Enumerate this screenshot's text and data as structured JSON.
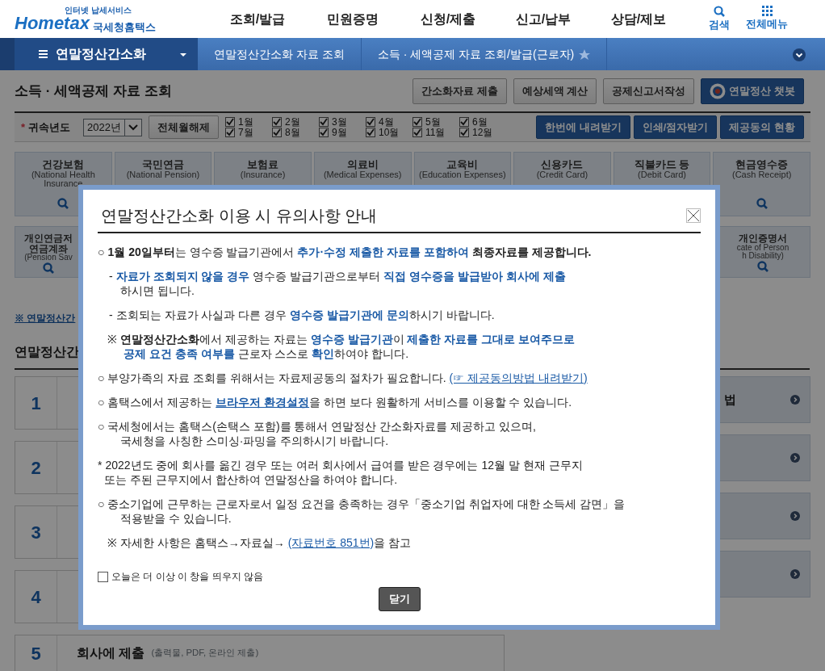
{
  "header": {
    "logo": {
      "tagline": "인터넷 납세서비스",
      "brand": "Hometax",
      "name": "국세청홈택스"
    },
    "menu": [
      "조회/발급",
      "민원증명",
      "신청/제출",
      "신고/납부",
      "상담/제보"
    ],
    "tools": [
      {
        "label": "검색",
        "kind": "search"
      },
      {
        "label": "전체메뉴",
        "kind": "grid"
      }
    ]
  },
  "breadcrumb": {
    "menu_title": "연말정산간소화",
    "items": [
      "연말정산간소화 자료 조회",
      "소득 · 세액공제 자료 조회/발급(근로자)"
    ],
    "favorite": false
  },
  "page": {
    "title": "소득 · 세액공제 자료 조회",
    "actions": [
      {
        "label": "간소화자료 제출",
        "kind": "default"
      },
      {
        "label": "예상세액 계산",
        "kind": "default"
      },
      {
        "label": "공제신고서작성",
        "kind": "default"
      },
      {
        "label": "연말정산 챗봇",
        "kind": "chatbot"
      }
    ]
  },
  "filter": {
    "required_mark": "*",
    "label": "귀속년도",
    "year": "2022년",
    "clear_button": "전체월해제",
    "months": [
      {
        "label": "1월",
        "checked": true
      },
      {
        "label": "7월",
        "checked": true
      },
      {
        "label": "2월",
        "checked": true
      },
      {
        "label": "8월",
        "checked": true
      },
      {
        "label": "3월",
        "checked": true
      },
      {
        "label": "9월",
        "checked": true
      },
      {
        "label": "4월",
        "checked": true
      },
      {
        "label": "10월",
        "checked": true
      },
      {
        "label": "5월",
        "checked": true
      },
      {
        "label": "11월",
        "checked": true
      },
      {
        "label": "6월",
        "checked": true
      },
      {
        "label": "12월",
        "checked": true
      }
    ],
    "actions": [
      "한번에 내려받기",
      "인쇄/점자받기",
      "제공동의 현황"
    ]
  },
  "categories": [
    {
      "title": "건강보험",
      "subtitle": [
        "(National Health",
        "Insurance"
      ],
      "search_icon": true
    },
    {
      "title": "국민연금",
      "subtitle": [
        "(National Pension)"
      ],
      "search_icon": false
    },
    {
      "title": "보험료",
      "subtitle": [
        "(Insurance)"
      ],
      "search_icon": false
    },
    {
      "title": "의료비",
      "subtitle": [
        "(Medical Expenses)"
      ],
      "search_icon": false
    },
    {
      "title": "교육비",
      "subtitle": [
        "(Education Expenses)"
      ],
      "search_icon": false
    },
    {
      "title": "신용카드",
      "subtitle": [
        "(Credit Card)"
      ],
      "search_icon": false
    },
    {
      "title": "직불카드 등",
      "subtitle": [
        "(Debit Card)"
      ],
      "search_icon": false
    },
    {
      "title": "현금영수증",
      "subtitle": [
        "(Cash Receipt)"
      ],
      "search_icon": true
    }
  ],
  "categories_row_2": [
    {
      "title": [
        "개인연금저",
        "연금계좌"
      ],
      "subtitle": [
        "(Pension Sav"
      ]
    },
    {
      "title": [
        "개인증명서"
      ],
      "subtitle": [
        "cate of Person",
        "h Disability)"
      ]
    }
  ],
  "notice_link": "※ 연말정산간",
  "section_title": "연말정산간",
  "steps": [
    {
      "number": "1"
    },
    {
      "number": "2"
    },
    {
      "number": "3"
    },
    {
      "number": "4"
    },
    {
      "number": "5",
      "title": "회사에 제출",
      "note": "(출력물, PDF, 온라인 제출)"
    }
  ],
  "side_links": [
    {
      "kind": "arrow",
      "label": "법"
    },
    {
      "kind": "arrow"
    },
    {
      "kind": "arrow"
    },
    {
      "kind": "arrow"
    }
  ],
  "modal": {
    "title": "연말정산간소화 이용 시 유의사항 안내",
    "blocks": [
      {
        "kind": "bullet",
        "marker": "○",
        "lines": [
          [
            {
              "text": "1월 20일부터",
              "kind": "bold"
            },
            {
              "text": "는 영수증 발급기관에서 ",
              "kind": "plain"
            },
            {
              "text": "추가·수정 제출한 자료를 포함하여",
              "kind": "blue"
            },
            {
              "text": " 최종자료를 제공합니다.",
              "kind": "bold"
            }
          ]
        ]
      },
      {
        "kind": "dash",
        "marker": "-",
        "lines": [
          [
            {
              "text": "자료가 조회되지 않을 경우",
              "kind": "blue"
            },
            {
              "text": " 영수증 발급기관으로부터 ",
              "kind": "plain"
            },
            {
              "text": "직접 영수증을 발급받아 회사에 제출",
              "kind": "blue"
            }
          ],
          [
            {
              "text": "하시면 됩니다.",
              "kind": "plain"
            }
          ]
        ]
      },
      {
        "kind": "dash",
        "marker": "-",
        "lines": [
          [
            {
              "text": "조회되는 자료가 사실과 다른 경우 ",
              "kind": "plain"
            },
            {
              "text": "영수증 발급기관에 문의",
              "kind": "blue"
            },
            {
              "text": "하시기 바랍니다.",
              "kind": "plain"
            }
          ]
        ]
      },
      {
        "kind": "note",
        "marker": "※",
        "lines": [
          [
            {
              "text": "연말정산간소화",
              "kind": "bold"
            },
            {
              "text": "에서 제공하는 자료는 ",
              "kind": "plain"
            },
            {
              "text": "영수증 발급기관",
              "kind": "blue"
            },
            {
              "text": "이 ",
              "kind": "plain"
            },
            {
              "text": "제출한 자료를 그대로 보여주므로",
              "kind": "blue"
            }
          ],
          [
            {
              "text": "공제 요건 충족 여부를",
              "kind": "blue"
            },
            {
              "text": " 근로자 스스로 ",
              "kind": "plain"
            },
            {
              "text": "확인",
              "kind": "blue"
            },
            {
              "text": "하여야 합니다.",
              "kind": "plain"
            }
          ]
        ]
      },
      {
        "kind": "bullet",
        "marker": "○",
        "lines": [
          [
            {
              "text": "부양가족의 자료 조회를 위해서는 자료제공동의 절차가 필요합니다. ",
              "kind": "plain"
            },
            {
              "text": "(☞ 제공동의방법 내려받기)",
              "kind": "link"
            }
          ]
        ]
      },
      {
        "kind": "bullet",
        "marker": "○",
        "lines": [
          [
            {
              "text": "홈택스에서 제공하는 ",
              "kind": "plain"
            },
            {
              "text": "브라우저 환경설정",
              "kind": "boldlink"
            },
            {
              "text": "을 하면 보다 원활하게 서비스를 이용할 수 있습니다.",
              "kind": "plain"
            }
          ]
        ]
      },
      {
        "kind": "bullet",
        "marker": "○",
        "lines": [
          [
            {
              "text": "국세청에서는 홈택스(손택스 포함)를 통해서 연말정산 간소화자료를 제공하고 있으며,",
              "kind": "plain"
            }
          ],
          [
            {
              "text": "국세청을 사칭한 스미싱·파밍을 주의하시기 바랍니다.",
              "kind": "plain"
            }
          ]
        ]
      },
      {
        "kind": "asterisk",
        "marker": "*",
        "lines": [
          [
            {
              "text": "2022년도 중에 회사를 옮긴 경우 또는 여러 회사에서 급여를 받은 경우에는 12월 말 현재 근무지",
              "kind": "plain"
            }
          ],
          [
            {
              "text": "또는 주된 근무지에서 합산하여 연말정산을 하여야 합니다.",
              "kind": "plain"
            }
          ]
        ]
      },
      {
        "kind": "bullet",
        "marker": "○",
        "lines": [
          [
            {
              "text": "중소기업에 근무하는 근로자로서 일정 요건을 충족하는 경우「중소기업 취업자에 대한 소득세 감면」을",
              "kind": "plain"
            }
          ],
          [
            {
              "text": "적용받을 수 있습니다.",
              "kind": "plain"
            }
          ]
        ]
      },
      {
        "kind": "note",
        "marker": "※",
        "lines": [
          [
            {
              "text": "자세한 사항은 홈택스→자료실→ ",
              "kind": "plain"
            },
            {
              "text": "(자료번호 851번)",
              "kind": "link"
            },
            {
              "text": "을 참고",
              "kind": "plain"
            }
          ]
        ]
      }
    ],
    "dont_show": {
      "label": "오늘은 더 이상 이 창을 띄우지 않음",
      "checked": false
    },
    "close_button": "닫기"
  }
}
